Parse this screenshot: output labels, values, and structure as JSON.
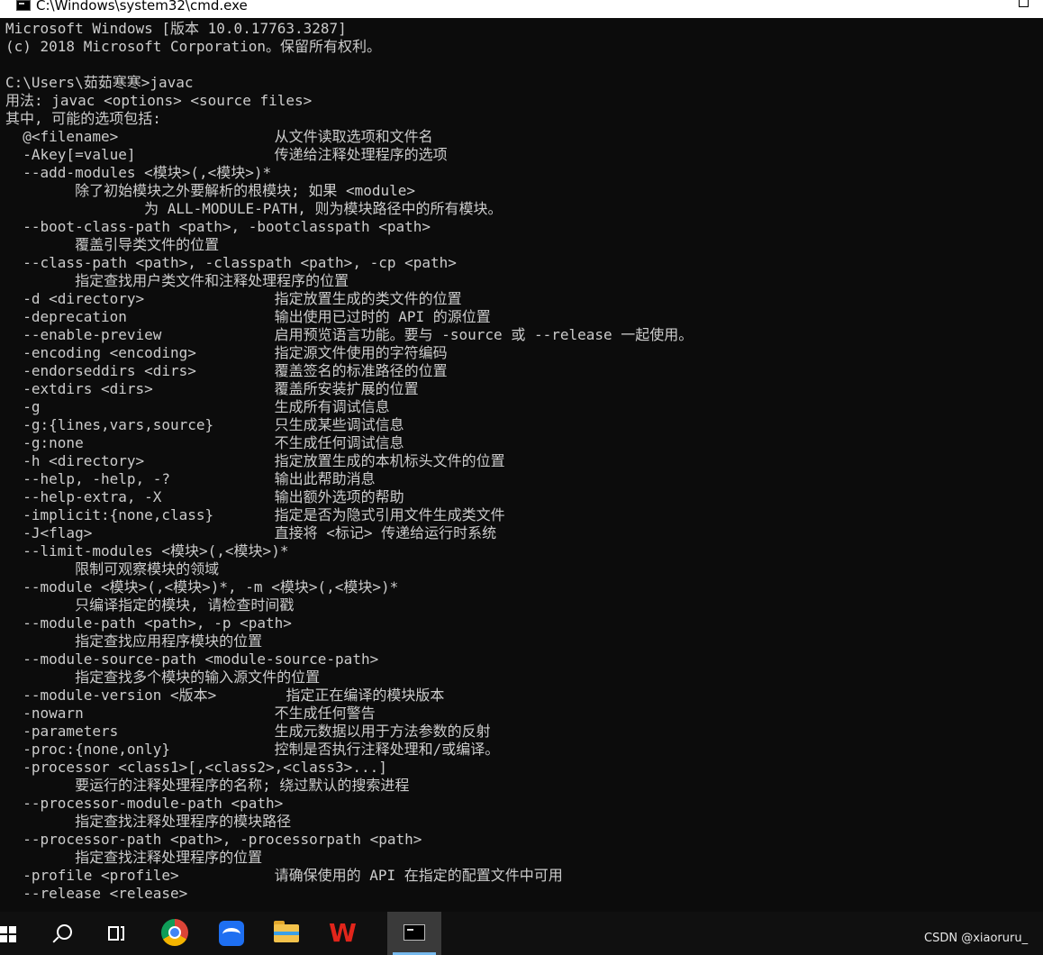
{
  "window": {
    "title": "C:\\Windows\\system32\\cmd.exe"
  },
  "terminal": {
    "lines": [
      "Microsoft Windows [版本 10.0.17763.3287]",
      "(c) 2018 Microsoft Corporation。保留所有权利。",
      "",
      "C:\\Users\\茹茹寒寒>javac",
      "用法: javac <options> <source files>",
      "其中, 可能的选项包括:",
      "  @<filename>                  从文件读取选项和文件名",
      "  -Akey[=value]                传递给注释处理程序的选项",
      "  --add-modules <模块>(,<模块>)*",
      "        除了初始模块之外要解析的根模块; 如果 <module>",
      "                为 ALL-MODULE-PATH, 则为模块路径中的所有模块。",
      "  --boot-class-path <path>, -bootclasspath <path>",
      "        覆盖引导类文件的位置",
      "  --class-path <path>, -classpath <path>, -cp <path>",
      "        指定查找用户类文件和注释处理程序的位置",
      "  -d <directory>               指定放置生成的类文件的位置",
      "  -deprecation                 输出使用已过时的 API 的源位置",
      "  --enable-preview             启用预览语言功能。要与 -source 或 --release 一起使用。",
      "  -encoding <encoding>         指定源文件使用的字符编码",
      "  -endorseddirs <dirs>         覆盖签名的标准路径的位置",
      "  -extdirs <dirs>              覆盖所安装扩展的位置",
      "  -g                           生成所有调试信息",
      "  -g:{lines,vars,source}       只生成某些调试信息",
      "  -g:none                      不生成任何调试信息",
      "  -h <directory>               指定放置生成的本机标头文件的位置",
      "  --help, -help, -?            输出此帮助消息",
      "  --help-extra, -X             输出额外选项的帮助",
      "  -implicit:{none,class}       指定是否为隐式引用文件生成类文件",
      "  -J<flag>                     直接将 <标记> 传递给运行时系统",
      "  --limit-modules <模块>(,<模块>)*",
      "        限制可观察模块的领域",
      "  --module <模块>(,<模块>)*, -m <模块>(,<模块>)*",
      "        只编译指定的模块, 请检查时间戳",
      "  --module-path <path>, -p <path>",
      "        指定查找应用程序模块的位置",
      "  --module-source-path <module-source-path>",
      "        指定查找多个模块的输入源文件的位置",
      "  --module-version <版本>        指定正在编译的模块版本",
      "  -nowarn                      不生成任何警告",
      "  -parameters                  生成元数据以用于方法参数的反射",
      "  -proc:{none,only}            控制是否执行注释处理和/或编译。",
      "  -processor <class1>[,<class2>,<class3>...]",
      "        要运行的注释处理程序的名称; 绕过默认的搜索进程",
      "  --processor-module-path <path>",
      "        指定查找注释处理程序的模块路径",
      "  --processor-path <path>, -processorpath <path>",
      "        指定查找注释处理程序的位置",
      "  -profile <profile>           请确保使用的 API 在指定的配置文件中可用",
      "  --release <release>"
    ]
  },
  "taskbar": {
    "icons": [
      "windows-start-icon",
      "search-icon",
      "task-view-icon",
      "chrome-icon",
      "blue-app-icon",
      "file-explorer-icon",
      "wps-icon",
      "command-prompt-icon"
    ],
    "tray_text": "CSDN @xiaoruru_"
  },
  "colors": {
    "terminal_bg": "#0c0c0c",
    "terminal_fg": "#cccccc",
    "titlebar_bg": "#ffffff",
    "taskbar_bg": "#101010",
    "active_indicator": "#76b9ed"
  }
}
